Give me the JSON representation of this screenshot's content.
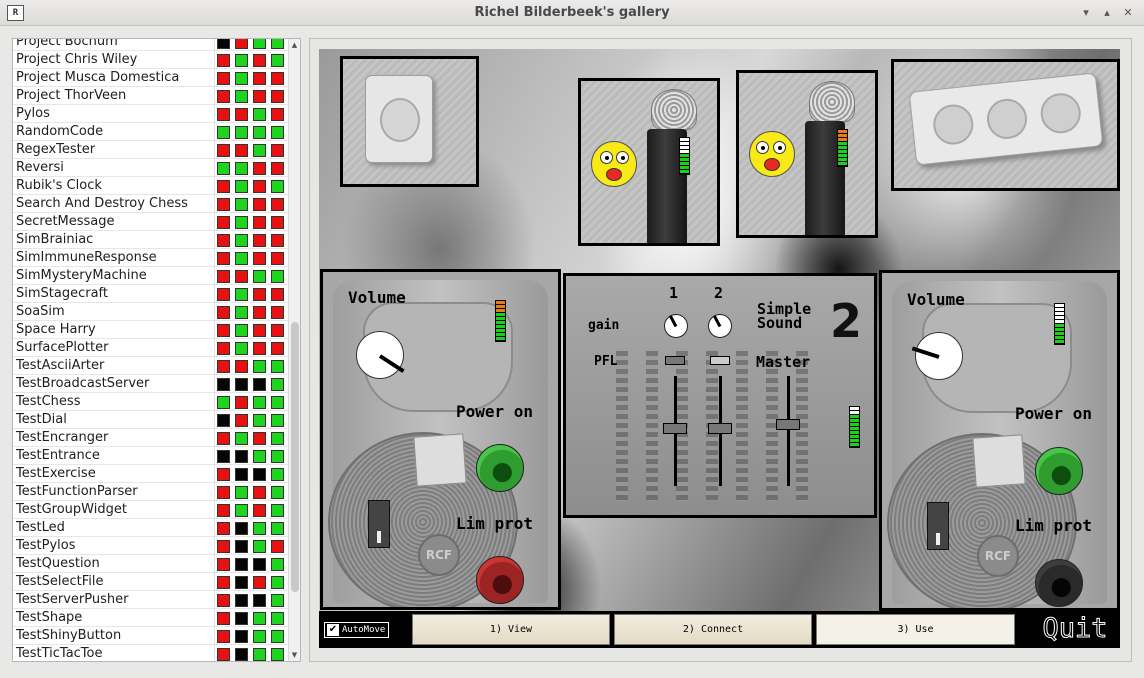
{
  "window": {
    "title": "Richel Bilderbeek's gallery",
    "icon_text": "R",
    "minimize_glyph": "▾",
    "maximize_glyph": "▴",
    "close_glyph": "✕"
  },
  "list": {
    "scroll_up_glyph": "▲",
    "scroll_down_glyph": "▼",
    "items": [
      {
        "name": "Project Bochum",
        "status": [
          "black",
          "red",
          "green",
          "green"
        ]
      },
      {
        "name": "Project Chris Wiley",
        "status": [
          "red",
          "green",
          "red",
          "green"
        ]
      },
      {
        "name": "Project Musca Domestica",
        "status": [
          "red",
          "green",
          "red",
          "red"
        ]
      },
      {
        "name": "Project ThorVeen",
        "status": [
          "red",
          "green",
          "red",
          "red"
        ]
      },
      {
        "name": "Pylos",
        "status": [
          "red",
          "red",
          "green",
          "red"
        ]
      },
      {
        "name": "RandomCode",
        "status": [
          "green",
          "green",
          "green",
          "green"
        ]
      },
      {
        "name": "RegexTester",
        "status": [
          "red",
          "red",
          "green",
          "red"
        ]
      },
      {
        "name": "Reversi",
        "status": [
          "green",
          "green",
          "red",
          "red"
        ]
      },
      {
        "name": "Rubik's Clock",
        "status": [
          "red",
          "green",
          "red",
          "green"
        ]
      },
      {
        "name": "Search And Destroy Chess",
        "status": [
          "red",
          "green",
          "red",
          "red"
        ]
      },
      {
        "name": "SecretMessage",
        "status": [
          "red",
          "green",
          "red",
          "red"
        ]
      },
      {
        "name": "SimBrainiac",
        "status": [
          "red",
          "green",
          "red",
          "red"
        ]
      },
      {
        "name": "SimImmuneResponse",
        "status": [
          "red",
          "green",
          "red",
          "red"
        ]
      },
      {
        "name": "SimMysteryMachine",
        "status": [
          "red",
          "red",
          "green",
          "green"
        ]
      },
      {
        "name": "SimStagecraft",
        "status": [
          "red",
          "green",
          "red",
          "red"
        ]
      },
      {
        "name": "SoaSim",
        "status": [
          "red",
          "green",
          "red",
          "red"
        ]
      },
      {
        "name": "Space Harry",
        "status": [
          "red",
          "green",
          "red",
          "red"
        ]
      },
      {
        "name": "SurfacePlotter",
        "status": [
          "red",
          "green",
          "red",
          "red"
        ]
      },
      {
        "name": "TestAsciiArter",
        "status": [
          "red",
          "red",
          "green",
          "green"
        ]
      },
      {
        "name": "TestBroadcastServer",
        "status": [
          "black",
          "black",
          "black",
          "green"
        ]
      },
      {
        "name": "TestChess",
        "status": [
          "green",
          "red",
          "green",
          "green"
        ]
      },
      {
        "name": "TestDial",
        "status": [
          "black",
          "red",
          "green",
          "green"
        ]
      },
      {
        "name": "TestEncranger",
        "status": [
          "red",
          "green",
          "red",
          "green"
        ]
      },
      {
        "name": "TestEntrance",
        "status": [
          "black",
          "black",
          "green",
          "green"
        ]
      },
      {
        "name": "TestExercise",
        "status": [
          "red",
          "black",
          "black",
          "green"
        ]
      },
      {
        "name": "TestFunctionParser",
        "status": [
          "red",
          "green",
          "red",
          "green"
        ]
      },
      {
        "name": "TestGroupWidget",
        "status": [
          "red",
          "green",
          "red",
          "green"
        ]
      },
      {
        "name": "TestLed",
        "status": [
          "red",
          "black",
          "green",
          "green"
        ]
      },
      {
        "name": "TestPylos",
        "status": [
          "red",
          "black",
          "green",
          "red"
        ]
      },
      {
        "name": "TestQuestion",
        "status": [
          "red",
          "black",
          "black",
          "green"
        ]
      },
      {
        "name": "TestSelectFile",
        "status": [
          "red",
          "black",
          "red",
          "green"
        ]
      },
      {
        "name": "TestServerPusher",
        "status": [
          "red",
          "black",
          "black",
          "green"
        ]
      },
      {
        "name": "TestShape",
        "status": [
          "red",
          "black",
          "green",
          "green"
        ]
      },
      {
        "name": "TestShinyButton",
        "status": [
          "red",
          "black",
          "green",
          "green"
        ]
      },
      {
        "name": "TestTicTacToe",
        "status": [
          "red",
          "black",
          "green",
          "green"
        ]
      }
    ]
  },
  "colors": {
    "red": "#e81111",
    "green": "#1ed41e",
    "black": "#050505",
    "vu_green": "#1ccf1c",
    "vu_orange": "#e87a1c",
    "vu_white": "#ffffff"
  },
  "speakers": {
    "left": {
      "volume_label": "Volume",
      "power_label": "Power on",
      "limprot_label": "Lim prot",
      "power_led": "green",
      "limprot_led": "red",
      "brand": "RCF"
    },
    "right": {
      "volume_label": "Volume",
      "power_label": "Power on",
      "limprot_label": "Lim prot",
      "power_led": "green",
      "limprot_led": "off",
      "brand": "RCF"
    }
  },
  "mixer": {
    "channel_1": "1",
    "channel_2": "2",
    "gain_label": "gain",
    "pfl_label": "PFL",
    "master_label": "Master",
    "brand_line1": "Simple",
    "brand_line2": "Sound",
    "brand_number": "2"
  },
  "bottom_bar": {
    "automove_label": "AutoMove",
    "automove_checked": "✔",
    "step1": "1) View",
    "step2": "2) Connect",
    "step3": "3) Use",
    "quit": "Quit"
  }
}
